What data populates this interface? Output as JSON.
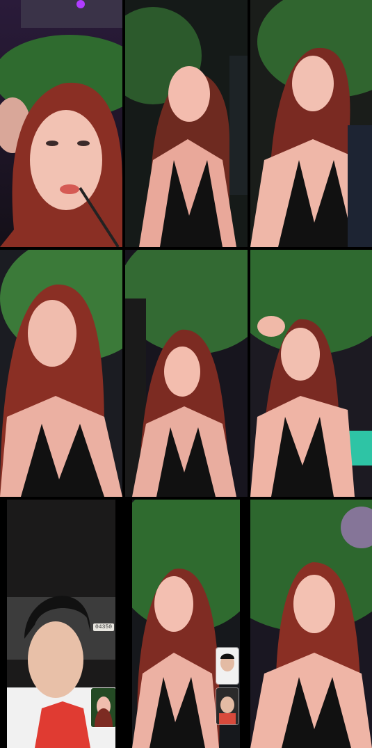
{
  "scene": {
    "description_tiles": 9,
    "icons": [
      "stage-light-icon",
      "person-silhouette-icon"
    ]
  },
  "tiles": [
    {
      "id": "r1c1"
    },
    {
      "id": "r1c2"
    },
    {
      "id": "r1c3"
    },
    {
      "id": "r2c1"
    },
    {
      "id": "r2c2"
    },
    {
      "id": "r2c3"
    },
    {
      "id": "r3c1"
    },
    {
      "id": "r3c2"
    },
    {
      "id": "r3c3"
    }
  ],
  "texts": {
    "car_plate": "04350"
  },
  "colors": {
    "divider": "#000000",
    "dress": "#111111",
    "hair": "#8a2f24",
    "skin": "#f0b9a8",
    "foliage": "#2f6b2f",
    "night_sky": "#1b1523",
    "pink_light": "#ff6fb3"
  }
}
